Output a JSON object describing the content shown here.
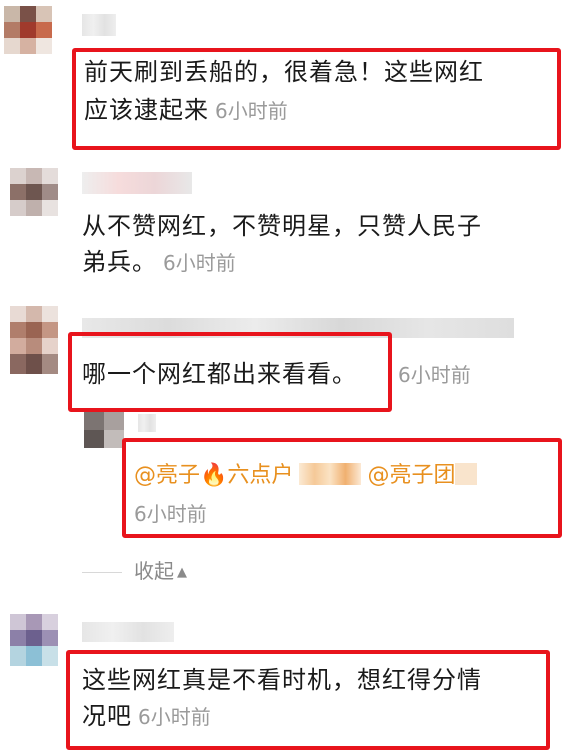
{
  "comments": [
    {
      "text_line1": "前天刷到丢船的，很着急！这些网红",
      "text_line2": "应该逮起来",
      "time": "6小时前"
    },
    {
      "text_line1": "从不赞网红，不赞明星，只赞人民子",
      "text_line2": "弟兵。",
      "time": "6小时前"
    },
    {
      "text_line1": "哪一个网红都出来看看。",
      "time": "6小时前",
      "reply": {
        "mention1": "@亮子",
        "fire_emoji": "🔥",
        "mention_rest": "六点户",
        "mention2": "@亮子团",
        "time": "6小时前"
      },
      "collapse_label": "收起",
      "collapse_arrow": "▲"
    },
    {
      "text_line1": "这些网红真是不看时机，想红得分情",
      "text_line2": "况吧",
      "time": "6小时前"
    }
  ],
  "colors": {
    "highlight_box": "#e8141c",
    "mention": "#e8901f",
    "timestamp": "#9a9a9a"
  }
}
